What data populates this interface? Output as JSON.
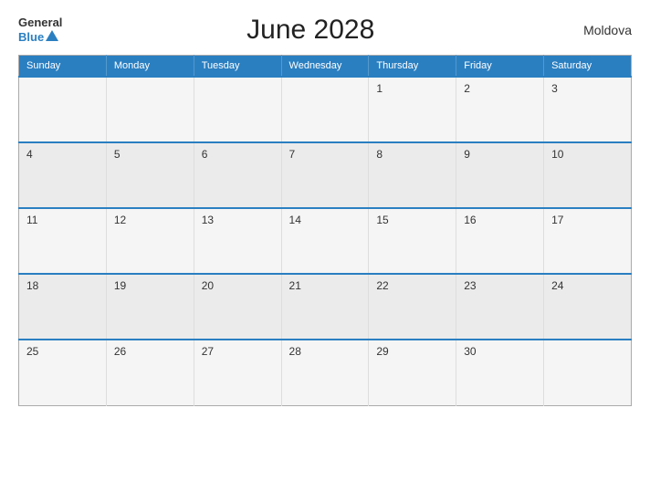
{
  "header": {
    "logo_general": "General",
    "logo_blue": "Blue",
    "title": "June 2028",
    "country": "Moldova"
  },
  "calendar": {
    "days_of_week": [
      "Sunday",
      "Monday",
      "Tuesday",
      "Wednesday",
      "Thursday",
      "Friday",
      "Saturday"
    ],
    "weeks": [
      [
        "",
        "",
        "",
        "",
        "1",
        "2",
        "3"
      ],
      [
        "4",
        "5",
        "6",
        "7",
        "8",
        "9",
        "10"
      ],
      [
        "11",
        "12",
        "13",
        "14",
        "15",
        "16",
        "17"
      ],
      [
        "18",
        "19",
        "20",
        "21",
        "22",
        "23",
        "24"
      ],
      [
        "25",
        "26",
        "27",
        "28",
        "29",
        "30",
        ""
      ]
    ]
  }
}
